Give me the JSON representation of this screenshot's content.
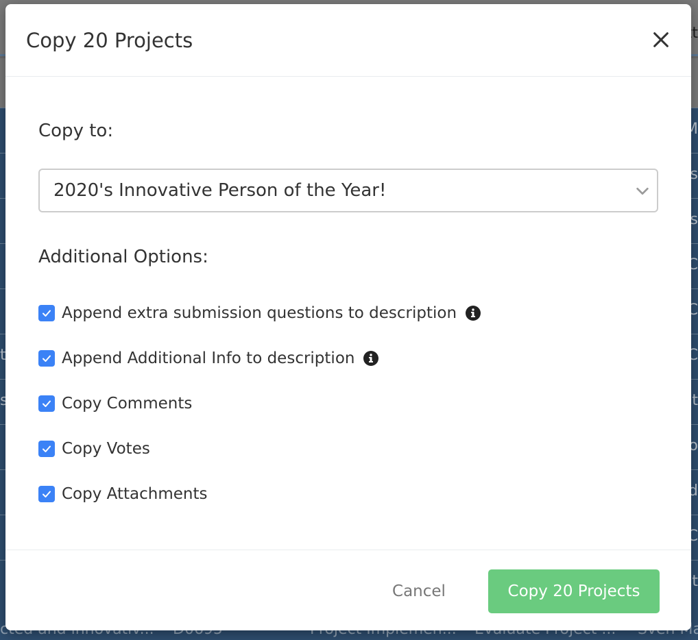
{
  "background": {
    "top_text": "tt",
    "row_fragments": [
      "M",
      "ls",
      "ls",
      "C",
      "C",
      "C",
      "t",
      "o",
      "d",
      "C",
      "t"
    ],
    "left_fragments": [
      "t",
      "s"
    ],
    "bottom_row": [
      "cted and innovativ...",
      "D0695",
      "Project Implemen...",
      "Evaluate Project ...",
      "Sven Ma"
    ]
  },
  "modal": {
    "title": "Copy 20 Projects",
    "copy_to_label": "Copy to:",
    "destination": {
      "selected": "2020's Innovative Person of the Year!"
    },
    "additional_options_label": "Additional Options:",
    "options": [
      {
        "label": "Append extra submission questions to description",
        "checked": true,
        "has_info": true
      },
      {
        "label": "Append Additional Info to description",
        "checked": true,
        "has_info": true
      },
      {
        "label": "Copy Comments",
        "checked": true,
        "has_info": false
      },
      {
        "label": "Copy Votes",
        "checked": true,
        "has_info": false
      },
      {
        "label": "Copy Attachments",
        "checked": true,
        "has_info": false
      }
    ],
    "cancel_label": "Cancel",
    "confirm_label": "Copy 20 Projects"
  },
  "colors": {
    "accent": "#3b82f6",
    "confirm": "#6acb7f"
  },
  "icons": {
    "close": "close-icon",
    "chevron": "chevron-down-icon",
    "check": "check-icon",
    "info": "info-icon"
  }
}
